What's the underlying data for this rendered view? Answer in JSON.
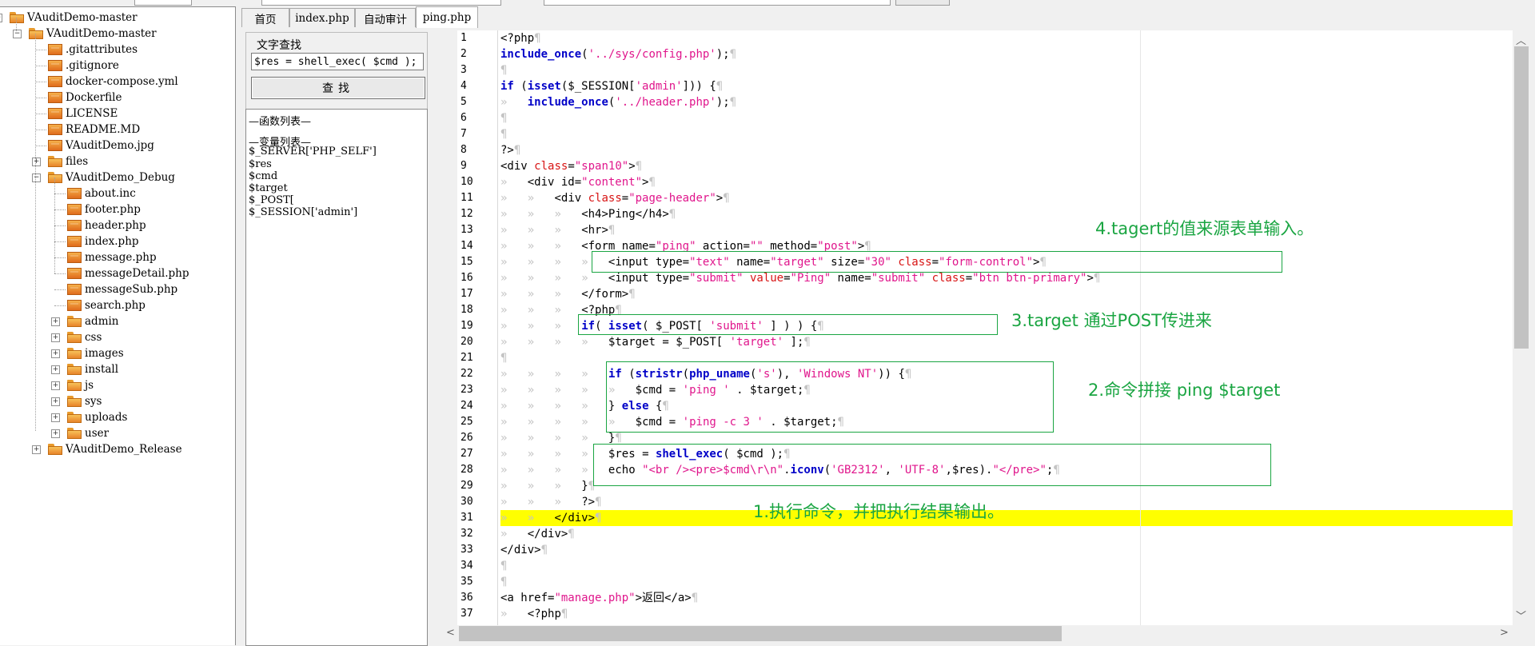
{
  "tree": {
    "items": [
      {
        "label": "VAuditDemo-master",
        "level": 0,
        "expander": "⊟",
        "kind": "folder"
      },
      {
        "label": "VAuditDemo-master",
        "level": 1,
        "expander": "⊟",
        "kind": "folder"
      },
      {
        "label": ".gitattributes",
        "level": 2,
        "kind": "file"
      },
      {
        "label": ".gitignore",
        "level": 2,
        "kind": "file"
      },
      {
        "label": "docker-compose.yml",
        "level": 2,
        "kind": "file"
      },
      {
        "label": "Dockerfile",
        "level": 2,
        "kind": "file"
      },
      {
        "label": "LICENSE",
        "level": 2,
        "kind": "file"
      },
      {
        "label": "README.MD",
        "level": 2,
        "kind": "file"
      },
      {
        "label": "VAuditDemo.jpg",
        "level": 2,
        "kind": "file"
      },
      {
        "label": "files",
        "level": 2,
        "expander": "⊞",
        "kind": "folder"
      },
      {
        "label": "VAuditDemo_Debug",
        "level": 2,
        "expander": "⊟",
        "kind": "folder"
      },
      {
        "label": "about.inc",
        "level": 3,
        "kind": "file"
      },
      {
        "label": "footer.php",
        "level": 3,
        "kind": "file"
      },
      {
        "label": "header.php",
        "level": 3,
        "kind": "file"
      },
      {
        "label": "index.php",
        "level": 3,
        "kind": "file"
      },
      {
        "label": "message.php",
        "level": 3,
        "kind": "file"
      },
      {
        "label": "messageDetail.php",
        "level": 3,
        "kind": "file"
      },
      {
        "label": "messageSub.php",
        "level": 3,
        "kind": "file"
      },
      {
        "label": "search.php",
        "level": 3,
        "kind": "file"
      },
      {
        "label": "admin",
        "level": 3,
        "expander": "⊞",
        "kind": "folder"
      },
      {
        "label": "css",
        "level": 3,
        "expander": "⊞",
        "kind": "folder"
      },
      {
        "label": "images",
        "level": 3,
        "expander": "⊞",
        "kind": "folder"
      },
      {
        "label": "install",
        "level": 3,
        "expander": "⊞",
        "kind": "folder"
      },
      {
        "label": "js",
        "level": 3,
        "expander": "⊞",
        "kind": "folder"
      },
      {
        "label": "sys",
        "level": 3,
        "expander": "⊞",
        "kind": "folder"
      },
      {
        "label": "uploads",
        "level": 3,
        "expander": "⊞",
        "kind": "folder"
      },
      {
        "label": "user",
        "level": 3,
        "expander": "⊞",
        "kind": "folder"
      },
      {
        "label": "VAuditDemo_Release",
        "level": 2,
        "expander": "⊞",
        "kind": "folder"
      }
    ]
  },
  "tabs": [
    "首页",
    "index.php",
    "自动审计",
    "ping.php"
  ],
  "search": {
    "title": "文字查找",
    "value": "$res = shell_exec( $cmd );",
    "button": "查找"
  },
  "lists": {
    "func_header": "—函数列表—",
    "var_header": "—变量列表—",
    "vars": [
      "$_SERVER['PHP_SELF']",
      "$res",
      "$cmd",
      "$target",
      "$_POST[",
      "$_SESSION['admin']"
    ]
  },
  "code": {
    "line_numbers": [
      "1",
      "2",
      "3",
      "4",
      "5",
      "6",
      "7",
      "8",
      "9",
      "10",
      "11",
      "12",
      "13",
      "14",
      "15",
      "16",
      "17",
      "18",
      "19",
      "20",
      "21",
      "22",
      "23",
      "24",
      "25",
      "26",
      "27",
      "28",
      "29",
      "30",
      "31",
      "32",
      "33",
      "34",
      "35",
      "36",
      "37"
    ],
    "lines": [
      "<?php",
      "include_once('../sys/config.php');",
      "",
      "if (isset($_SESSION['admin'])) {",
      "    include_once('../header.php');",
      "",
      "",
      "?>",
      "<div class=\"span10\">",
      "    <div id=\"content\">",
      "        <div class=\"page-header\">",
      "            <h4>Ping</h4>",
      "            <hr>",
      "            <form name=\"ping\" action=\"\" method=\"post\">",
      "                <input type=\"text\" name=\"target\" size=\"30\" class=\"form-control\">",
      "                <input type=\"submit\" value=\"Ping\" name=\"submit\" class=\"btn btn-primary\">",
      "            </form>",
      "            <?php",
      "            if( isset( $_POST[ 'submit' ] ) ) {",
      "                $target = $_POST[ 'target' ];",
      "",
      "                if (stristr(php_uname('s'), 'Windows NT')) {",
      "                    $cmd = 'ping ' . $target;",
      "                } else {",
      "                    $cmd = 'ping -c 3 ' . $target;",
      "                }",
      "                $res = shell_exec( $cmd );",
      "                echo \"<br /><pre>$cmd\\r\\n\".iconv('GB2312', 'UTF-8',$res).\"</pre>\";",
      "            }",
      "            ?>",
      "        </div>",
      "    </div>",
      "</div>",
      "",
      "",
      "<a href=\"manage.php\">返回</a>",
      "    <?php"
    ],
    "highlight_line": 31
  },
  "annotations": {
    "a1": "1.执行命令，并把执行结果输出。",
    "a2": "2.命令拼接  ping $target",
    "a3": "3.target 通过POST传进来",
    "a4": "4.tagert的值来源表单输入。"
  },
  "colors": {
    "annotation": "#1aa542",
    "highlight": "#ffff00",
    "keyword": "#0000c8",
    "string": "#e0168c",
    "attr": "#d81414"
  }
}
